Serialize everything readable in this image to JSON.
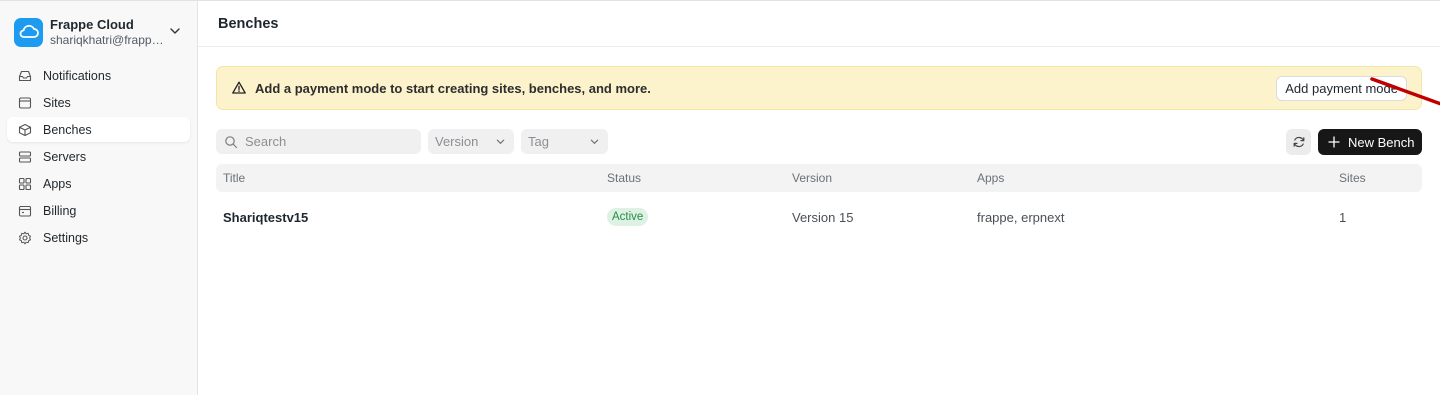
{
  "sidebar": {
    "brand": {
      "name": "Frappe Cloud",
      "email": "shariqkhatri@frappe.io"
    },
    "items": [
      {
        "label": "Notifications",
        "icon": "inbox-icon"
      },
      {
        "label": "Sites",
        "icon": "browser-icon"
      },
      {
        "label": "Benches",
        "icon": "package-icon",
        "active": true
      },
      {
        "label": "Servers",
        "icon": "server-icon"
      },
      {
        "label": "Apps",
        "icon": "grid-icon"
      },
      {
        "label": "Billing",
        "icon": "wallet-icon"
      },
      {
        "label": "Settings",
        "icon": "gear-icon"
      }
    ]
  },
  "header": {
    "title": "Benches"
  },
  "banner": {
    "message": "Add a payment mode to start creating sites, benches, and more.",
    "button_label": "Add payment mode"
  },
  "toolbar": {
    "search_placeholder": "Search",
    "version_select": "Version",
    "tag_select": "Tag",
    "new_button_label": "New Bench"
  },
  "table": {
    "columns": [
      "Title",
      "Status",
      "Version",
      "Apps",
      "Sites"
    ],
    "rows": [
      {
        "title": "Shariqtestv15",
        "status": "Active",
        "version": "Version 15",
        "apps": "frappe, erpnext",
        "sites": "1"
      }
    ]
  },
  "colors": {
    "brand": "#1c9bf0",
    "banner_bg": "#fcf3cc",
    "primary_button": "#171717",
    "status_active": "#2a8a48",
    "annotation_arrow": "#c00000"
  }
}
